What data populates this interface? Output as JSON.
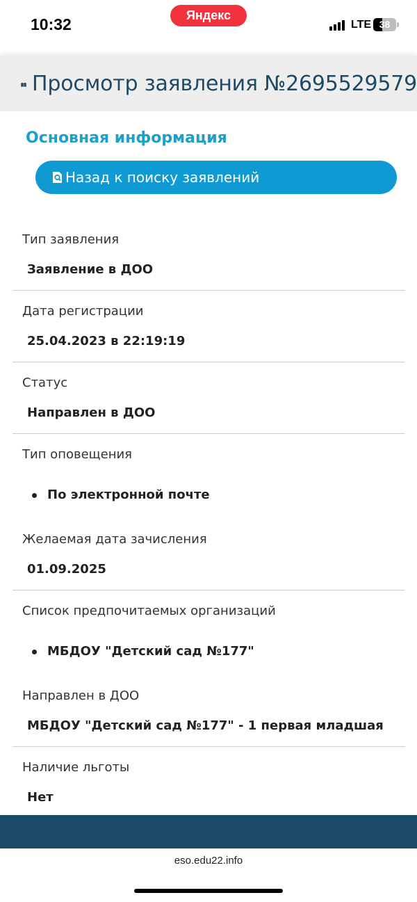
{
  "status_bar": {
    "time": "10:32",
    "yandex_label": "Яндекс",
    "network": "LTE",
    "battery": "38"
  },
  "header": {
    "icon": "book-open-icon",
    "title": "Просмотр заявления №2695529579"
  },
  "section": {
    "title": "Основная информация",
    "back_button_icon": "document-search-icon",
    "back_button_label": "Назад к поиску заявлений"
  },
  "fields": {
    "application_type": {
      "label": "Тип заявления",
      "value": "Заявление в ДОО"
    },
    "registration_date": {
      "label": "Дата регистрации",
      "value": "25.04.2023 в 22:19:19"
    },
    "status": {
      "label": "Статус",
      "value": "Направлен в ДОО"
    },
    "notification_type": {
      "label": "Тип оповещения",
      "items": [
        "По электронной почте"
      ]
    },
    "desired_date": {
      "label": "Желаемая дата зачисления",
      "value": "01.09.2025"
    },
    "preferred_orgs": {
      "label": "Список предпочитаемых организаций",
      "items": [
        "МБДОУ \"Детский сад №177\""
      ]
    },
    "sent_to": {
      "label": "Направлен в ДОО",
      "value": "МБДОУ \"Детский сад №177\" - 1 первая младшая"
    },
    "benefit": {
      "label": "Наличие льготы",
      "value": "Нет"
    }
  },
  "browser": {
    "url": "eso.edu22.info"
  },
  "colors": {
    "accent": "#109ad3",
    "section_title": "#1e9fc9",
    "header_title": "#1f4a66",
    "footer": "#1c4a66",
    "yandex": "#f2323c"
  }
}
